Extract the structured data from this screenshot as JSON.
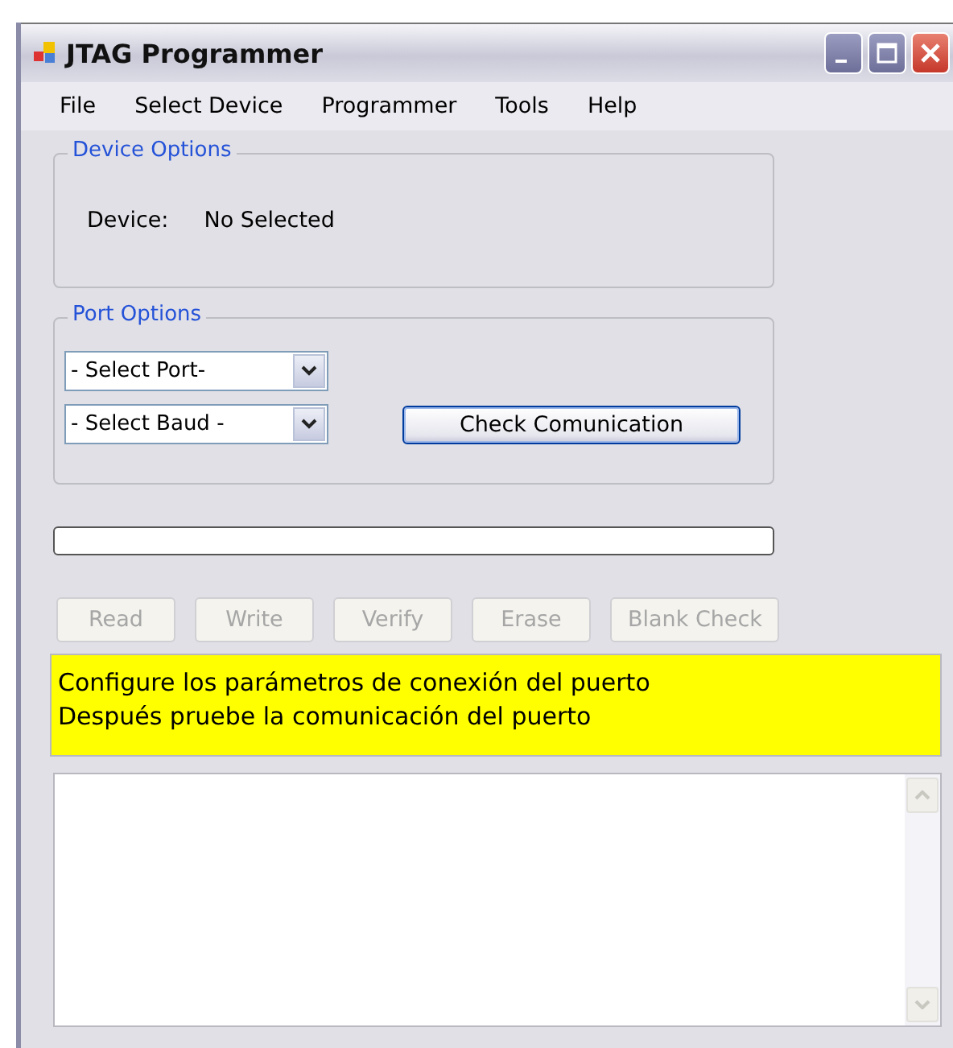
{
  "window": {
    "title": "JTAG Programmer"
  },
  "menu": [
    {
      "label": "File"
    },
    {
      "label": "Select Device"
    },
    {
      "label": "Programmer"
    },
    {
      "label": "Tools"
    },
    {
      "label": "Help"
    }
  ],
  "device_options": {
    "title": "Device Options",
    "label": "Device:",
    "value": "No Selected"
  },
  "port_options": {
    "title": "Port Options",
    "port": {
      "value": "- Select Port-"
    },
    "baud": {
      "value": "- Select Baud -"
    },
    "check_button": {
      "label": "Check Comunication",
      "disabled": false
    }
  },
  "actions": [
    {
      "label": "Read",
      "disabled": true
    },
    {
      "label": "Write",
      "disabled": true
    },
    {
      "label": "Verify",
      "disabled": true
    },
    {
      "label": "Erase",
      "disabled": true
    },
    {
      "label": "Blank Check",
      "disabled": true
    }
  ],
  "message": {
    "lines": [
      "Configure los parámetros de conexión del puerto",
      "Después pruebe la comunicación del puerto"
    ]
  }
}
